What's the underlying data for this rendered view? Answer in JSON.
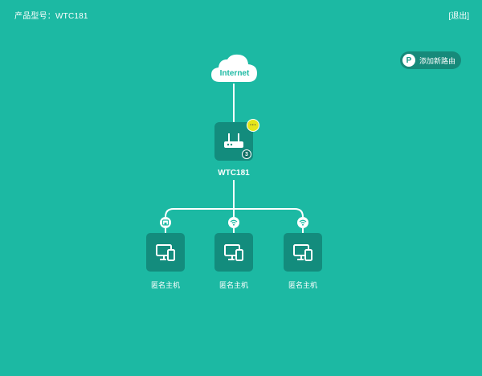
{
  "header": {
    "model_label": "产品型号：WTC181",
    "logout_label": "[退出]"
  },
  "add_router": {
    "label": "添加新路由",
    "icon_letter": "P"
  },
  "internet": {
    "label": "Internet"
  },
  "router": {
    "name": "WTC181",
    "badge": "···",
    "client_count": "3"
  },
  "hosts": [
    {
      "name": "匿名主机",
      "connection": "wired"
    },
    {
      "name": "匿名主机",
      "connection": "wifi"
    },
    {
      "name": "匿名主机",
      "connection": "wifi"
    }
  ],
  "colors": {
    "background": "#1cb9a3",
    "tile": "#138c7d",
    "badge": "#e5e51a"
  }
}
